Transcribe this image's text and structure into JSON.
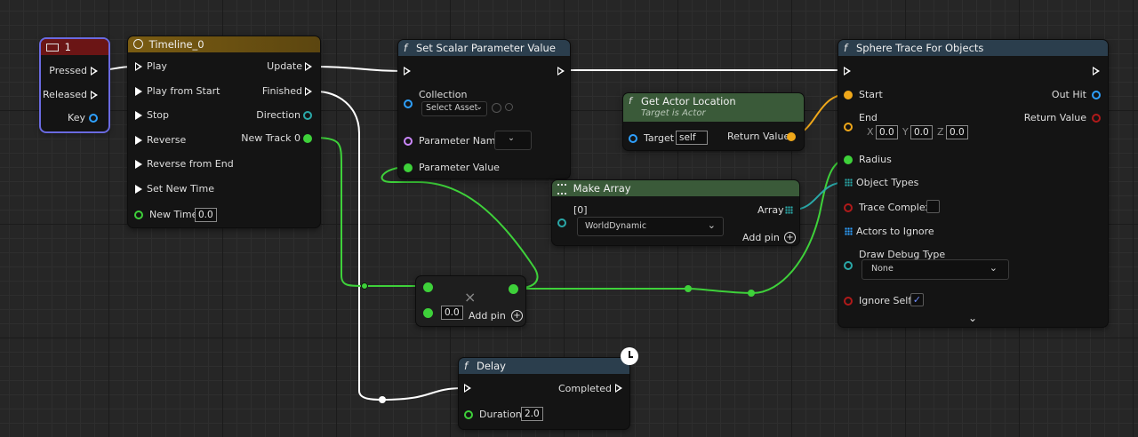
{
  "colors": {
    "exec": "#ffffff",
    "float": "#3ed13a",
    "object": "#2ea0ff",
    "struct": "#f0a81a",
    "bool": "#b01a1a",
    "name": "#cc88ff",
    "header_function": "#2b3e4d",
    "header_timeline": "#7a5c12",
    "header_event": "#6b1515",
    "header_pure": "#3a5a39"
  },
  "key_event": {
    "title": "1",
    "icon": "keyboard-icon",
    "pins": [
      "Pressed",
      "Released",
      "Key"
    ]
  },
  "timeline": {
    "title": "Timeline_0",
    "icon": "clock-icon",
    "inputs": [
      "Play",
      "Play from Start",
      "Stop",
      "Reverse",
      "Reverse from End",
      "Set New Time",
      "New Time"
    ],
    "new_time_value": "0.0",
    "outputs": [
      "Update",
      "Finished",
      "Direction",
      "New Track 0"
    ]
  },
  "set_scalar": {
    "title": "Set Scalar Parameter Value",
    "collection_label": "Collection",
    "collection_value": "Select Asset",
    "param_name_label": "Parameter Name",
    "param_value_label": "Parameter Value"
  },
  "get_actor_location": {
    "title": "Get Actor Location",
    "subtitle": "Target is Actor",
    "target_label": "Target",
    "target_value": "self",
    "return_label": "Return Value"
  },
  "make_array": {
    "title": "Make Array",
    "index_label": "[0]",
    "element_value": "WorldDynamic",
    "array_label": "Array",
    "add_pin_label": "Add pin"
  },
  "sphere_trace": {
    "title": "Sphere Trace For Objects",
    "start_label": "Start",
    "end_label": "End",
    "x_label": "X",
    "y_label": "Y",
    "z_label": "Z",
    "x_value": "0.0",
    "y_value": "0.0",
    "z_value": "0.0",
    "radius_label": "Radius",
    "object_types_label": "Object Types",
    "trace_complex_label": "Trace Complex",
    "actors_to_ignore_label": "Actors to Ignore",
    "draw_debug_label": "Draw Debug Type",
    "draw_debug_value": "None",
    "ignore_self_label": "Ignore Self",
    "out_hit_label": "Out Hit",
    "return_label": "Return Value"
  },
  "multiply_node": {
    "value": "0.0",
    "add_pin_label": "Add pin",
    "operator_symbol": "×"
  },
  "delay": {
    "title": "Delay",
    "completed_label": "Completed",
    "duration_label": "Duration",
    "duration_value": "2.0",
    "latent_icon": "clock-icon"
  }
}
